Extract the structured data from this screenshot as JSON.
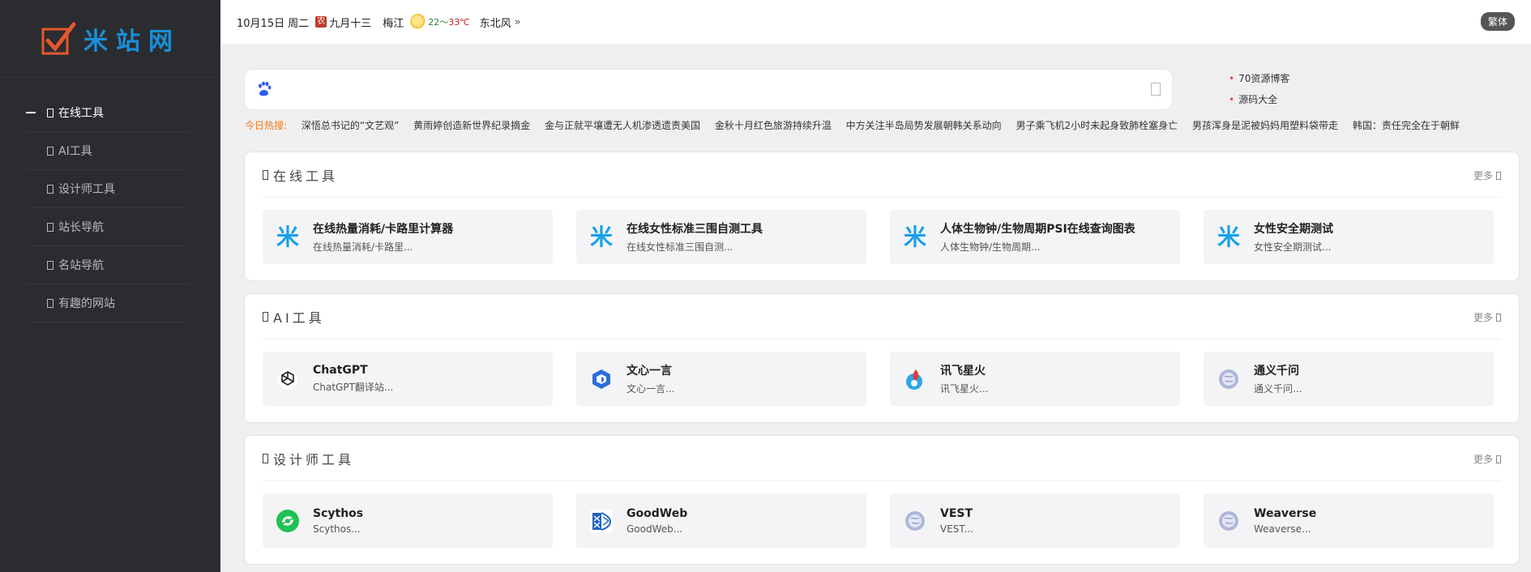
{
  "brand": {
    "name": "米站网"
  },
  "sidebar": {
    "items": [
      {
        "label": "在线工具",
        "active": true
      },
      {
        "label": "AI工具"
      },
      {
        "label": "设计师工具"
      },
      {
        "label": "站长导航"
      },
      {
        "label": "名站导航"
      },
      {
        "label": "有趣的网站"
      }
    ]
  },
  "topbar": {
    "date": "10月15日 周二",
    "lunar_badge": "农",
    "lunar_date": "九月十三",
    "city": "梅江",
    "temp_low": "22",
    "temp_sep": "～",
    "temp_high": "33℃",
    "wind": "东北风",
    "wind_chevron": "»",
    "lang_button": "繁体"
  },
  "search": {
    "value": "",
    "placeholder": ""
  },
  "side_links": [
    "70资源博客",
    "源码大全"
  ],
  "hot": {
    "label": "今日热搜:",
    "items": [
      "深悟总书记的“文艺观”",
      "黄雨婷创造新世界纪录摘金",
      "金与正就平壤遭无人机渗透遗责美国",
      "金秋十月红色旅游持续升温",
      "中方关注半岛局势发展朝韩关系动向",
      "男子乘飞机2小时未起身致肺栓塞身亡",
      "男孩浑身是泥被妈妈用塑料袋带走",
      "韩国：责任完全在于朝鲜 ..."
    ]
  },
  "sections": [
    {
      "title": "在线工具",
      "more": "更多",
      "cards": [
        {
          "title": "在线热量消耗/卡路里计算器",
          "desc": "在线热量消耗/卡路里...",
          "icon": "mi-icon"
        },
        {
          "title": "在线女性标准三围自测工具",
          "desc": "在线女性标准三围自测...",
          "icon": "mi-icon"
        },
        {
          "title": "人体生物钟/生物周期PSI在线查询图表",
          "desc": "人体生物钟/生物周期...",
          "icon": "mi-icon"
        },
        {
          "title": "女性安全期测试",
          "desc": "女性安全期测试...",
          "icon": "mi-icon"
        }
      ]
    },
    {
      "title": "AI工具",
      "more": "更多",
      "cards": [
        {
          "title": "ChatGPT",
          "desc": "ChatGPT翻译站...",
          "icon": "openai-icon"
        },
        {
          "title": "文心一言",
          "desc": "文心一言...",
          "icon": "wenxin-icon"
        },
        {
          "title": "讯飞星火",
          "desc": "讯飞星火...",
          "icon": "xinghuo-icon"
        },
        {
          "title": "通义千问",
          "desc": "通义千问...",
          "icon": "globe-icon"
        }
      ]
    },
    {
      "title": "设计师工具",
      "more": "更多",
      "cards": [
        {
          "title": "Scythos",
          "desc": "Scythos...",
          "icon": "scythos-icon"
        },
        {
          "title": "GoodWeb",
          "desc": "GoodWeb...",
          "icon": "goodweb-icon"
        },
        {
          "title": "VEST",
          "desc": "VEST...",
          "icon": "globe-icon"
        },
        {
          "title": "Weaverse",
          "desc": "Weaverse...",
          "icon": "globe-icon"
        }
      ]
    }
  ]
}
